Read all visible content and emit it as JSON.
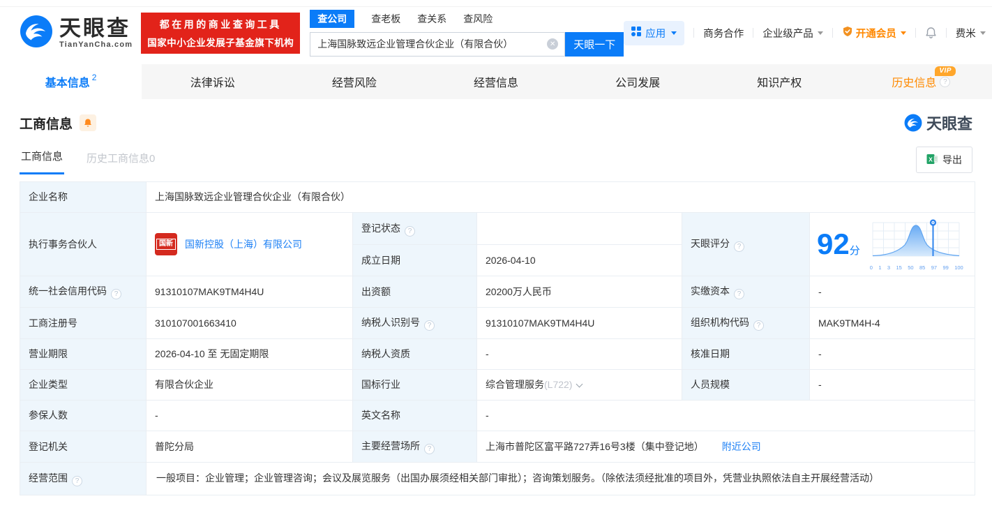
{
  "brand": {
    "logo_text": "天眼查",
    "logo_domain": "TianYanCha.com",
    "slogan_line1": "都在用的商业查询工具",
    "slogan_line2": "国家中小企业发展子基金旗下机构",
    "watermark_text": "天眼查"
  },
  "search": {
    "tabs": [
      "查公司",
      "查老板",
      "查关系",
      "查风险"
    ],
    "input_value": "上海国脉致远企业管理合伙企业（有限合伙）",
    "button_label": "天眼一下"
  },
  "menu": {
    "apps": "应用",
    "business": "商务合作",
    "enterprise": "企业级产品",
    "vip": "开通会员",
    "user": "费米"
  },
  "nav": {
    "tabs": [
      {
        "label": "基本信息",
        "badge": "2"
      },
      {
        "label": "法律诉讼"
      },
      {
        "label": "经营风险"
      },
      {
        "label": "经营信息"
      },
      {
        "label": "公司发展"
      },
      {
        "label": "知识产权"
      },
      {
        "label": "历史信息",
        "vip_badge": "VIP"
      }
    ]
  },
  "section": {
    "title": "工商信息",
    "subtab_active": "工商信息",
    "subtab_inactive": "历史工商信息0",
    "export_label": "导出"
  },
  "score": {
    "label": "天眼评分",
    "value": "92",
    "unit": "分",
    "axis": [
      "0",
      "1",
      "3",
      "15",
      "50",
      "85",
      "97",
      "99",
      "100"
    ]
  },
  "info": {
    "company_name_label": "企业名称",
    "company_name": "上海国脉致远企业管理合伙企业（有限合伙）",
    "partner_label": "执行事务合伙人",
    "partner_logo_text": "国新",
    "partner_name": "国新控股（上海）有限公司",
    "reg_status_label": "登记状态",
    "reg_status_value": "",
    "establish_label": "成立日期",
    "establish_value": "2026-04-10",
    "credit_code_label": "统一社会信用代码",
    "credit_code": "91310107MAK9TM4H4U",
    "capital_label": "出资额",
    "capital": "20200万人民币",
    "paid_capital_label": "实缴资本",
    "paid_capital": "-",
    "reg_number_label": "工商注册号",
    "reg_number": "310107001663410",
    "taxpayer_id_label": "纳税人识别号",
    "taxpayer_id": "91310107MAK9TM4H4U",
    "org_code_label": "组织机构代码",
    "org_code": "MAK9TM4H-4",
    "business_term_label": "营业期限",
    "business_term": "2026-04-10 至 无固定期限",
    "taxpayer_quality_label": "纳税人资质",
    "taxpayer_quality": "-",
    "approval_date_label": "核准日期",
    "approval_date": "-",
    "company_type_label": "企业类型",
    "company_type": "有限合伙企业",
    "industry_label": "国标行业",
    "industry": "综合管理服务",
    "industry_code": "(L722)",
    "staff_size_label": "人员规模",
    "staff_size": "-",
    "insured_label": "参保人数",
    "insured": "-",
    "english_name_label": "英文名称",
    "english_name": "-",
    "reg_authority_label": "登记机关",
    "reg_authority": "普陀分局",
    "address_label": "主要经营场所",
    "address": "上海市普陀区富平路727弄16号3楼（集中登记地）",
    "nearby_link": "附近公司",
    "scope_label": "经营范围",
    "scope": "一般项目：企业管理；企业管理咨询；会议及展览服务（出国办展须经相关部门审批）；咨询策划服务。（除依法须经批准的项目外，凭营业执照依法自主开展经营活动）"
  },
  "icons": {
    "help_glyph": "?",
    "clear_glyph": "✕"
  },
  "colors": {
    "brand_blue": "#0b7cf8",
    "banner_red": "#e2231a",
    "vip_orange": "#ff8a00",
    "link_blue": "#1d80f5",
    "label_bg": "#eef6fc",
    "excel_green": "#21a366",
    "logo_red": "#d42a1f"
  }
}
